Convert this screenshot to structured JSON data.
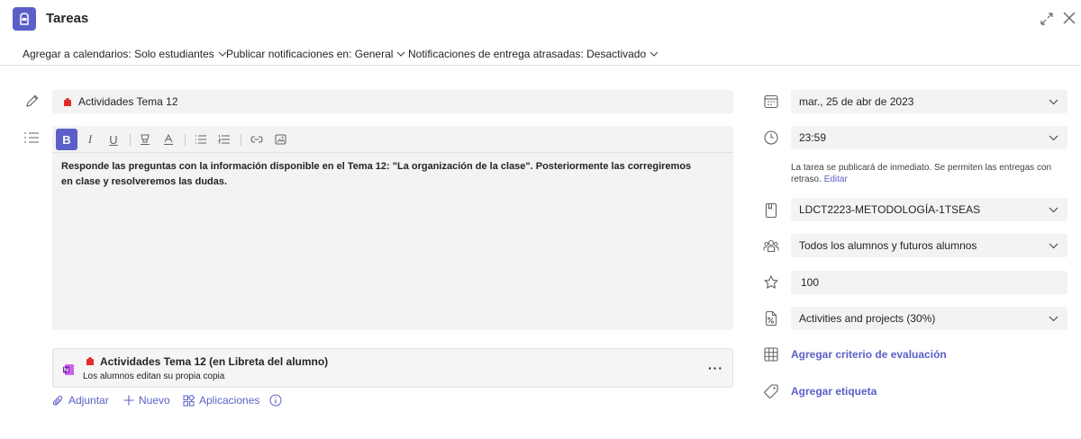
{
  "app": {
    "title": "Tareas",
    "accent": "#5b5fc7"
  },
  "settings": [
    {
      "label": "Agregar a calendarios: Solo estudiantes"
    },
    {
      "label": "Publicar notificaciones en: General"
    },
    {
      "label": "Notificaciones de entrega atrasadas: Desactivado"
    }
  ],
  "assignment": {
    "title": "Actividades Tema 12",
    "instructions": "Responde las preguntas con la información disponible en el Tema 12: \"La organización de la clase\". Posteriormente las corregiremos en clase y resolveremos las dudas."
  },
  "toolbar": {
    "bold": "B",
    "italic": "I",
    "underline": "U"
  },
  "attachment": {
    "title": "Actividades Tema 12 (en Libreta del alumno)",
    "subtitle": "Los alumnos editan su propia copia",
    "more": "···"
  },
  "actions": {
    "attach": "Adjuntar",
    "new": "Nuevo",
    "apps": "Aplicaciones"
  },
  "right": {
    "due_date": "mar., 25 de abr de 2023",
    "due_time": "23:59",
    "publish_note": "La tarea se publicará de inmediato. Se permiten las entregas con retraso.",
    "publish_edit": "Editar",
    "class": "LDCT2223-METODOLOGÍA-1TSEAS",
    "students": "Todos los alumnos y futuros alumnos",
    "points": "100",
    "category": "Activities and projects (30%)",
    "add_rubric": "Agregar criterio de evaluación",
    "add_tag": "Agregar etiqueta"
  }
}
